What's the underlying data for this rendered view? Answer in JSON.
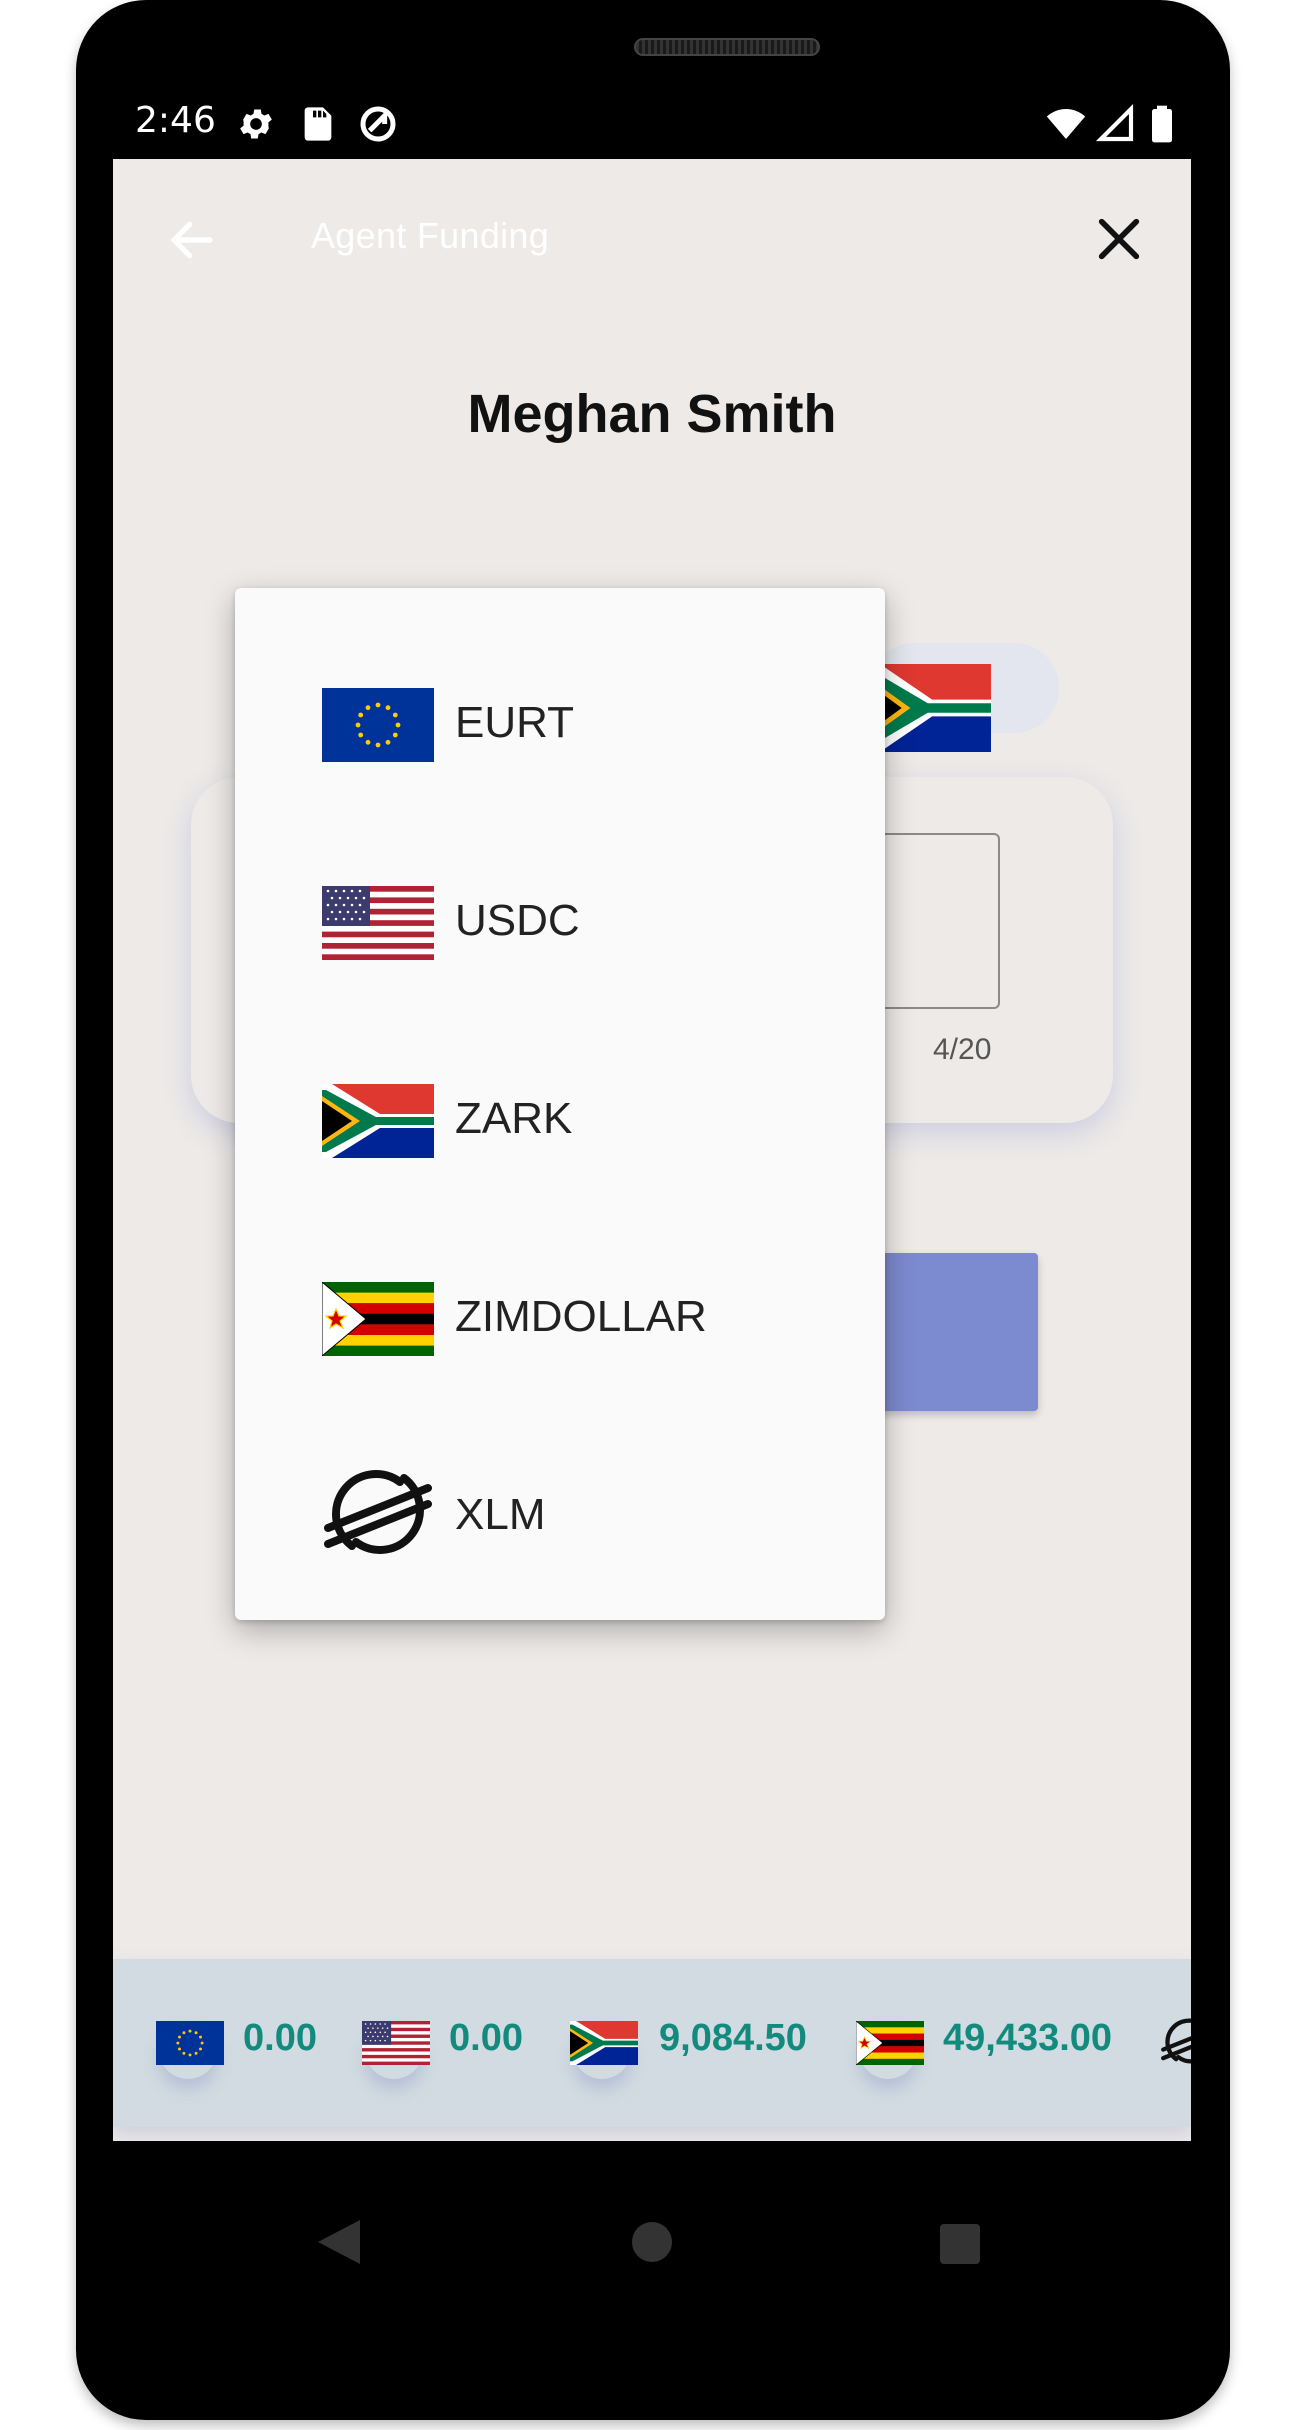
{
  "status_bar": {
    "time": "2:46",
    "icons_left": [
      "settings-gear-icon",
      "sd-card-icon",
      "sync-icon"
    ],
    "icons_right": [
      "wifi-icon",
      "cell-signal-icon",
      "battery-icon"
    ]
  },
  "app_bar": {
    "title": "Agent Funding",
    "back_icon": "arrow-left-icon",
    "close_icon": "close-icon"
  },
  "user": {
    "name": "Meghan Smith"
  },
  "form": {
    "selected_currency_flag": "south-africa-flag",
    "char_counter": "4/20"
  },
  "currency_menu": {
    "items": [
      {
        "label": "EURT",
        "icon": "eu-flag"
      },
      {
        "label": "USDC",
        "icon": "us-flag"
      },
      {
        "label": "ZARK",
        "icon": "south-africa-flag"
      },
      {
        "label": "ZIMDOLLAR",
        "icon": "zimbabwe-flag"
      },
      {
        "label": "XLM",
        "icon": "stellar-logo"
      }
    ]
  },
  "balances": [
    {
      "icon": "eu-flag",
      "value": "0.00"
    },
    {
      "icon": "us-flag",
      "value": "0.00"
    },
    {
      "icon": "south-africa-flag",
      "value": "9,084.50"
    },
    {
      "icon": "zimbabwe-flag",
      "value": "49,433.00"
    },
    {
      "icon": "stellar-logo",
      "value": ""
    }
  ],
  "colors": {
    "accent_button": "#7c8acf",
    "balance_text": "#128a7e",
    "background": "#edeae8"
  }
}
